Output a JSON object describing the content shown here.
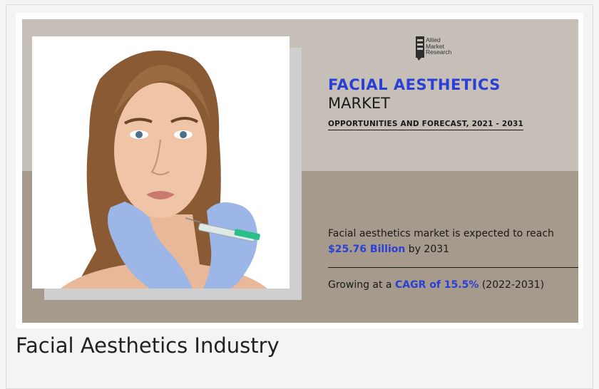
{
  "logo": {
    "line1": "Allied",
    "line2": "Market",
    "line3": "Research",
    "icon": "allied-market-research-logo"
  },
  "banner": {
    "title": "FACIAL AESTHETICS",
    "subtitle": "MARKET",
    "tagline": "OPPORTUNITIES AND FORECAST, 2021 - 2031",
    "stat1_prefix": "Facial aesthetics market is expected to reach",
    "stat1_value": "$25.76 Billion",
    "stat1_suffix": " by 2031",
    "stat2_prefix": "Growing at a ",
    "stat2_value": "CAGR of 15.5%",
    "stat2_suffix": " (2022-2031)"
  },
  "caption": "Facial Aesthetics Industry",
  "colors": {
    "accent_blue": "#2a3fd4",
    "band_top": "#c6bfb8",
    "band_bottom": "#a59a8c"
  }
}
